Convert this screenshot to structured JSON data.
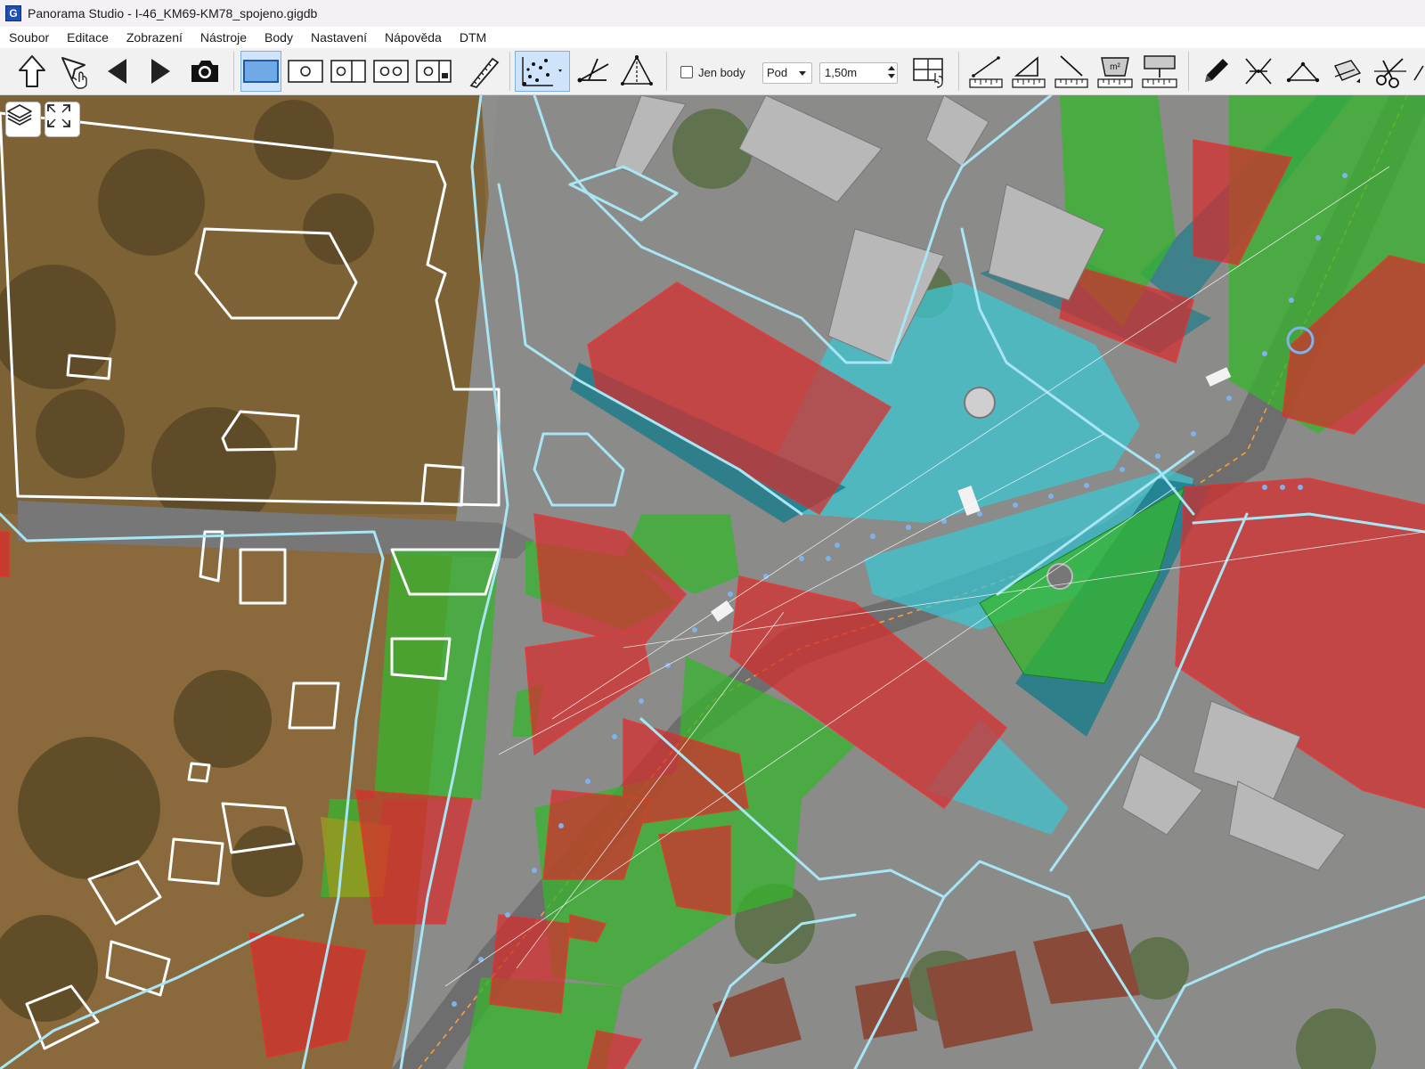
{
  "window": {
    "app_icon_letter": "G",
    "title": "Panorama Studio - I-46_KM69-KM78_spojeno.gigdb"
  },
  "menu": [
    {
      "label": "Soubor"
    },
    {
      "label": "Editace"
    },
    {
      "label": "Zobrazení"
    },
    {
      "label": "Nástroje"
    },
    {
      "label": "Body"
    },
    {
      "label": "Nastavení"
    },
    {
      "label": "Nápověda"
    },
    {
      "label": "DTM"
    }
  ],
  "toolbar": {
    "points_only_label": "Jen body",
    "points_only_checked": false,
    "layer_select_value": "Pod",
    "offset_value": "1,50m",
    "area_unit_label": "m²",
    "active_tool": "point-cloud-tool"
  },
  "map": {
    "layers_button": "layers-icon",
    "fullscreen_button": "fullscreen-icon",
    "colors": {
      "building_red": "#d62c2c",
      "vegetation_green": "#36b52c",
      "paved_cyan": "#3cc6d2",
      "boundary_line": "#a8e6f5",
      "outline_white": "#ffffff"
    }
  }
}
